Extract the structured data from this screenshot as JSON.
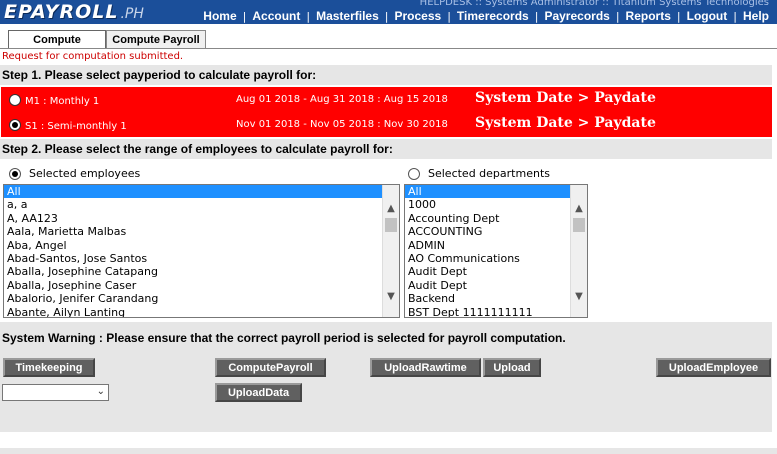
{
  "header": {
    "logo_main": "EPAYROLL",
    "logo_suffix": ".PH",
    "helpdesk": "HELPDESK :: Systems Administrator :: Titanium Systems Technologies",
    "nav": [
      "Home",
      "Account",
      "Masterfiles",
      "Process",
      "Timerecords",
      "Payrecords",
      "Reports",
      "Logout",
      "Help"
    ],
    "bg_color": "#1b4f9a"
  },
  "tabs": [
    {
      "label": "Compute",
      "active": true
    },
    {
      "label": "Compute Payroll",
      "active": false
    }
  ],
  "status_message": "Request for computation submitted.",
  "step1": {
    "title": "Step 1. Please select payperiod to calculate payroll for:",
    "periods": [
      {
        "code": "M1 : Monthly 1",
        "dates": "Aug 01 2018 - Aug 31 2018 : Aug 15 2018",
        "note": "System Date > Paydate",
        "checked": false
      },
      {
        "code": "S1 : Semi-monthly 1",
        "dates": "Nov 01 2018 - Nov 05 2018 : Nov 30 2018",
        "note": "System Date > Paydate",
        "checked": true
      }
    ],
    "highlight_color": "#ff0000"
  },
  "step2": {
    "title": "Step 2. Please select the range of employees to calculate payroll for:",
    "employees_label": "Selected employees",
    "departments_label": "Selected departments",
    "employees": [
      "All",
      "a, a",
      "A, AA123",
      "Aala, Marietta Malbas",
      "Aba, Angel",
      "Abad-Santos, Jose Santos",
      "Aballa, Josephine Catapang",
      "Aballa, Josephine Caser",
      "Abalorio, Jenifer Carandang",
      "Abante, Ailyn Lanting"
    ],
    "departments": [
      "All",
      "1000",
      "Accounting Dept",
      "ACCOUNTING",
      "ADMIN",
      "AO Communications",
      "Audit Dept",
      "Audit Dept",
      "Backend",
      "BST Dept 1111111111"
    ]
  },
  "warning": "System Warning : Please ensure that the correct payroll period is selected for payroll computation.",
  "buttons": {
    "timekeeping": "Timekeeping",
    "compute_payroll": "ComputePayroll",
    "upload_rawtime": "UploadRawtime",
    "upload": "Upload",
    "upload_employee": "UploadEmployee",
    "upload_data": "UploadData"
  },
  "select_value": ""
}
